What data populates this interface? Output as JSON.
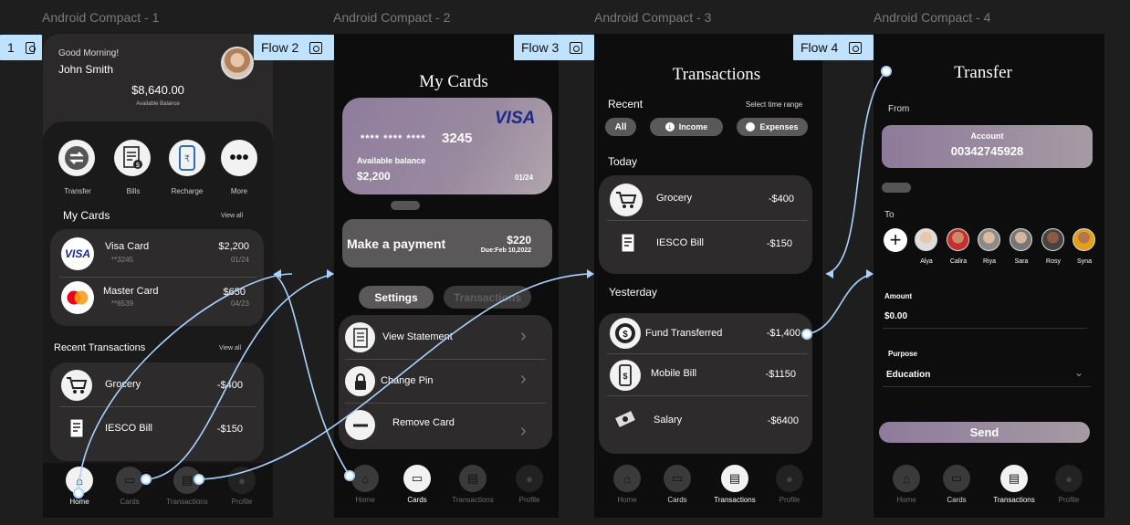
{
  "frames": [
    {
      "title": "Android Compact - 1"
    },
    {
      "title": "Android Compact - 2"
    },
    {
      "title": "Android Compact - 3"
    },
    {
      "title": "Android Compact - 4"
    }
  ],
  "flow_tags": {
    "f1": "1",
    "f2": "Flow 2",
    "f3": "Flow 3",
    "f4": "Flow 4"
  },
  "home": {
    "greeting": "Good Morning!",
    "user_name": "John Smith",
    "balance": "$8,640.00",
    "balance_label": "Available Balance",
    "quick_actions": [
      "Transfer",
      "Bills",
      "Recharge",
      "More"
    ],
    "my_cards_title": "My Cards",
    "view_all": "View all",
    "cards": [
      {
        "name": "Visa Card",
        "number": "**3245",
        "amount": "$2,200",
        "expiry": "01/24",
        "brand": "VISA"
      },
      {
        "name": "Master Card",
        "number": "**6539",
        "amount": "$650",
        "expiry": "04/23"
      }
    ],
    "recent_title": "Recent Transactions",
    "recent": [
      {
        "name": "Grocery",
        "amount": "-$400"
      },
      {
        "name": "IESCO Bill",
        "amount": "-$150"
      }
    ]
  },
  "nav": {
    "home": "Home",
    "cards": "Cards",
    "transactions": "Transactions",
    "profile": "Profile"
  },
  "cards_screen": {
    "title": "My Cards",
    "brand": "VISA",
    "card_mask": "**** **** ****",
    "card_last": "3245",
    "balance_label": "Available balance",
    "balance": "$2,200",
    "expiry": "01/24",
    "payment_label": "Make a payment",
    "payment_amount": "$220",
    "payment_due": "Due:Feb 10,2022",
    "tab_settings": "Settings",
    "tab_transactions": "Transactions",
    "options": [
      "View Statement",
      "Change Pin",
      "Remove Card"
    ]
  },
  "tx_screen": {
    "title": "Transactions",
    "recent": "Recent",
    "time_range": "Select time range",
    "filter_all": "All",
    "filter_income": "Income",
    "filter_expenses": "Expenses",
    "today": "Today",
    "today_items": [
      {
        "name": "Grocery",
        "amount": "-$400"
      },
      {
        "name": "IESCO Bill",
        "amount": "-$150"
      }
    ],
    "yesterday": "Yesterday",
    "yesterday_items": [
      {
        "name": "Fund Transferred",
        "amount": "-$1,400"
      },
      {
        "name": "Mobile Bill",
        "amount": "-$1150"
      },
      {
        "name": "Salary",
        "amount": "-$6400"
      }
    ]
  },
  "transfer": {
    "title": "Transfer",
    "from_label": "From",
    "account_label": "Account",
    "account_number": "00342745928",
    "to_label": "To",
    "contacts": [
      "Alya",
      "Calira",
      "Riya",
      "Sara",
      "Rosy",
      "Syna"
    ],
    "amount_label": "Amount",
    "amount_value": "$0.00",
    "purpose_label": "Purpose",
    "purpose_value": "Education",
    "send": "Send"
  },
  "colors": {
    "accent_purple": "#8e7a9c",
    "wire_blue": "#a9d3ff",
    "panel": "#2d2b2c"
  }
}
